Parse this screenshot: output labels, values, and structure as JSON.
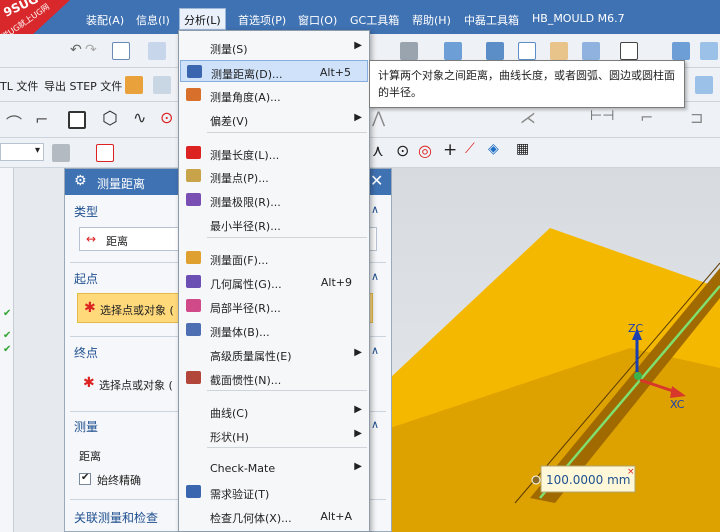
{
  "logo": {
    "line1": "9SUG",
    "line2": "学UG就上UG网"
  },
  "menubar": {
    "items": [
      "装配(A)",
      "信息(I)",
      "分析(L)",
      "首选项(P)",
      "窗口(O)",
      "GC工具箱",
      "帮助(H)",
      "中磊工具箱",
      "HB_MOULD M6.7"
    ],
    "active_index": 2
  },
  "toolbar2": {
    "export_tl": "TL 文件",
    "export_step": "导出 STEP 文件"
  },
  "analysis_menu": {
    "items": [
      {
        "label": "测量(S)",
        "shortcut": "",
        "submenu": true,
        "icon": ""
      },
      {
        "label": "测量距离(D)...",
        "shortcut": "Alt+5",
        "submenu": false,
        "icon": "measure-distance-icon",
        "active": true
      },
      {
        "label": "测量角度(A)...",
        "shortcut": "",
        "submenu": false,
        "icon": "measure-angle-icon"
      },
      {
        "label": "偏差(V)",
        "shortcut": "",
        "submenu": true,
        "icon": ""
      },
      {
        "label": "测量长度(L)...",
        "shortcut": "",
        "submenu": false,
        "icon": "measure-length-icon"
      },
      {
        "label": "测量点(P)...",
        "shortcut": "",
        "submenu": false,
        "icon": "measure-point-icon"
      },
      {
        "label": "测量极限(R)...",
        "shortcut": "",
        "submenu": false,
        "icon": "measure-limit-icon"
      },
      {
        "label": "最小半径(R)...",
        "shortcut": "",
        "submenu": false,
        "icon": ""
      },
      {
        "label": "测量面(F)...",
        "shortcut": "",
        "submenu": false,
        "icon": "measure-face-icon"
      },
      {
        "label": "几何属性(G)...",
        "shortcut": "Alt+9",
        "submenu": false,
        "icon": "geometric-properties-icon"
      },
      {
        "label": "局部半径(R)...",
        "shortcut": "",
        "submenu": false,
        "icon": "local-radius-icon"
      },
      {
        "label": "测量体(B)...",
        "shortcut": "",
        "submenu": false,
        "icon": "measure-body-icon"
      },
      {
        "label": "高级质量属性(E)",
        "shortcut": "",
        "submenu": true,
        "icon": ""
      },
      {
        "label": "截面惯性(N)...",
        "shortcut": "",
        "submenu": false,
        "icon": "section-inertia-icon"
      },
      {
        "label": "曲线(C)",
        "shortcut": "",
        "submenu": true,
        "icon": ""
      },
      {
        "label": "形状(H)",
        "shortcut": "",
        "submenu": true,
        "icon": ""
      },
      {
        "label": "Check-Mate",
        "shortcut": "",
        "submenu": true,
        "icon": ""
      },
      {
        "label": "需求验证(T)",
        "shortcut": "",
        "submenu": false,
        "icon": "requirements-icon"
      },
      {
        "label": "检查几何体(X)...",
        "shortcut": "Alt+A",
        "submenu": false,
        "icon": ""
      }
    ]
  },
  "tooltip": {
    "text": "计算两个对象之间距离，曲线长度，或者圆弧、圆边或圆柱面的半径。"
  },
  "dialog": {
    "title": "测量距离",
    "type_header": "类型",
    "type_value": "距离",
    "start_header": "起点",
    "start_select": "选择点或对象 (",
    "end_header": "终点",
    "end_select": "选择点或对象 (",
    "measure_header": "测量",
    "distance_label": "距离",
    "always_accurate": "始终精确",
    "associated_header": "关联测量和检查"
  },
  "viewport": {
    "zc_label": "ZC",
    "xc_label": "XC",
    "measurement": "100.0000 mm"
  },
  "colors": {
    "title_blue": "#3f72b3",
    "part_yellow": "#f5b800",
    "highlight": "#ffd97a"
  }
}
